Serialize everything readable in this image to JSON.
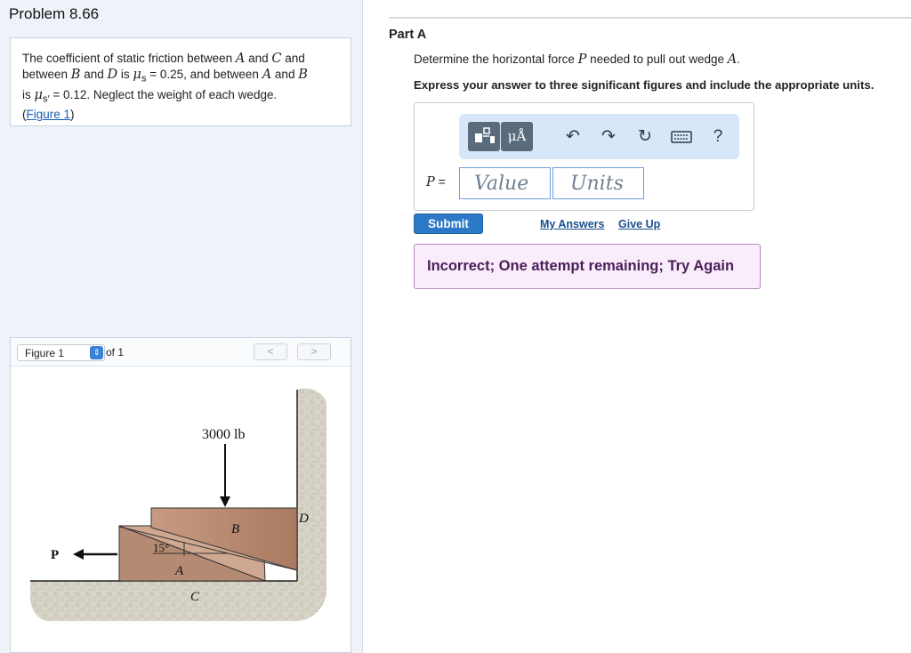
{
  "problem": {
    "title": "Problem 8.66",
    "text_1": "The coefficient of static friction between ",
    "sym_a": "A",
    "text_2": " and ",
    "sym_c": "C",
    "text_3": " and",
    "text_4": "between ",
    "sym_b": "B",
    "text_5": " and ",
    "sym_d": "D",
    "text_6": " is ",
    "mu_s": "μ",
    "mu_s_sub": "s",
    "text_7": " = 0.25, and between ",
    "sym_a2": "A",
    "text_8": " and ",
    "sym_b2": "B",
    "text_9": "is ",
    "mu_s2": "μ",
    "mu_s2_sub": "s′",
    "text_10": " = 0.12. Neglect the weight of each wedge.",
    "figure_link_open": "(",
    "figure_link": "Figure 1",
    "figure_link_close": ")"
  },
  "figure_panel": {
    "selected": "Figure 1",
    "of_text": "of 1",
    "prev_icon": "<",
    "next_icon": ">",
    "labels": {
      "load": "3000 lb",
      "force": "P",
      "wedge_b": "B",
      "wedge_a": "A",
      "wall": "D",
      "floor": "C",
      "angle": "15°"
    }
  },
  "part": {
    "title": "Part A",
    "q_1": "Determine the horizontal force ",
    "q_sym_p": "P",
    "q_2": " needed to pull out wedge ",
    "q_sym_a": "A",
    "q_3": ".",
    "instruction": "Express your answer to three significant figures and include the appropriate units."
  },
  "answer": {
    "toolbar": {
      "mu_button": "μÅ",
      "undo_icon": "↶",
      "redo_icon": "↷",
      "reset_icon": "↻",
      "help_label": "?"
    },
    "p_label_sym": "P",
    "p_label_eq": " =",
    "value_placeholder": "Value",
    "units_placeholder": "Units"
  },
  "actions": {
    "submit": "Submit",
    "my_answers": "My Answers",
    "give_up": "Give Up"
  },
  "feedback": "Incorrect; One attempt remaining; Try Again"
}
